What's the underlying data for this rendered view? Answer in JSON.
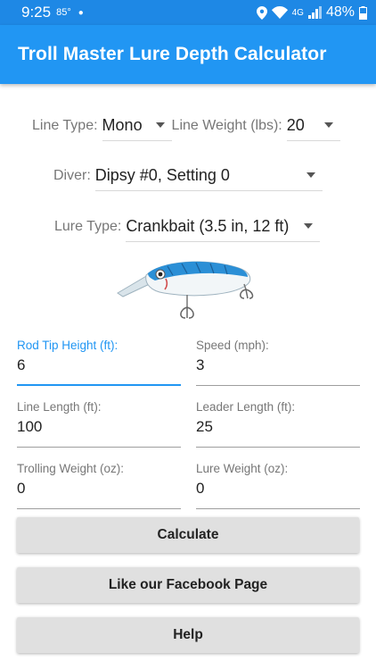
{
  "status_bar": {
    "time": "9:25",
    "temperature": "85°",
    "network": "4G",
    "battery": "48%"
  },
  "app_bar": {
    "title": "Troll Master Lure Depth Calculator"
  },
  "line_type": {
    "label": "Line Type:",
    "value": "Mono"
  },
  "line_weight": {
    "label": "Line Weight (lbs):",
    "value": "20"
  },
  "diver": {
    "label": "Diver:",
    "value": "Dipsy #0, Setting 0"
  },
  "lure_type": {
    "label": "Lure Type:",
    "value": "Crankbait (3.5 in, 12 ft)"
  },
  "fields": {
    "rod_tip_height": {
      "label": "Rod Tip Height (ft):",
      "value": "6"
    },
    "speed": {
      "label": "Speed (mph):",
      "value": "3"
    },
    "line_length": {
      "label": "Line Length (ft):",
      "value": "100"
    },
    "leader_length": {
      "label": "Leader Length (ft):",
      "value": "25"
    },
    "trolling_weight": {
      "label": "Trolling Weight (oz):",
      "value": "0"
    },
    "lure_weight": {
      "label": "Lure Weight (oz):",
      "value": "0"
    }
  },
  "buttons": {
    "calculate": "Calculate",
    "facebook": "Like our Facebook Page",
    "help": "Help"
  },
  "colors": {
    "primary": "#2196f3",
    "status_bar": "#1e88e5",
    "button": "#e0e0e0"
  }
}
